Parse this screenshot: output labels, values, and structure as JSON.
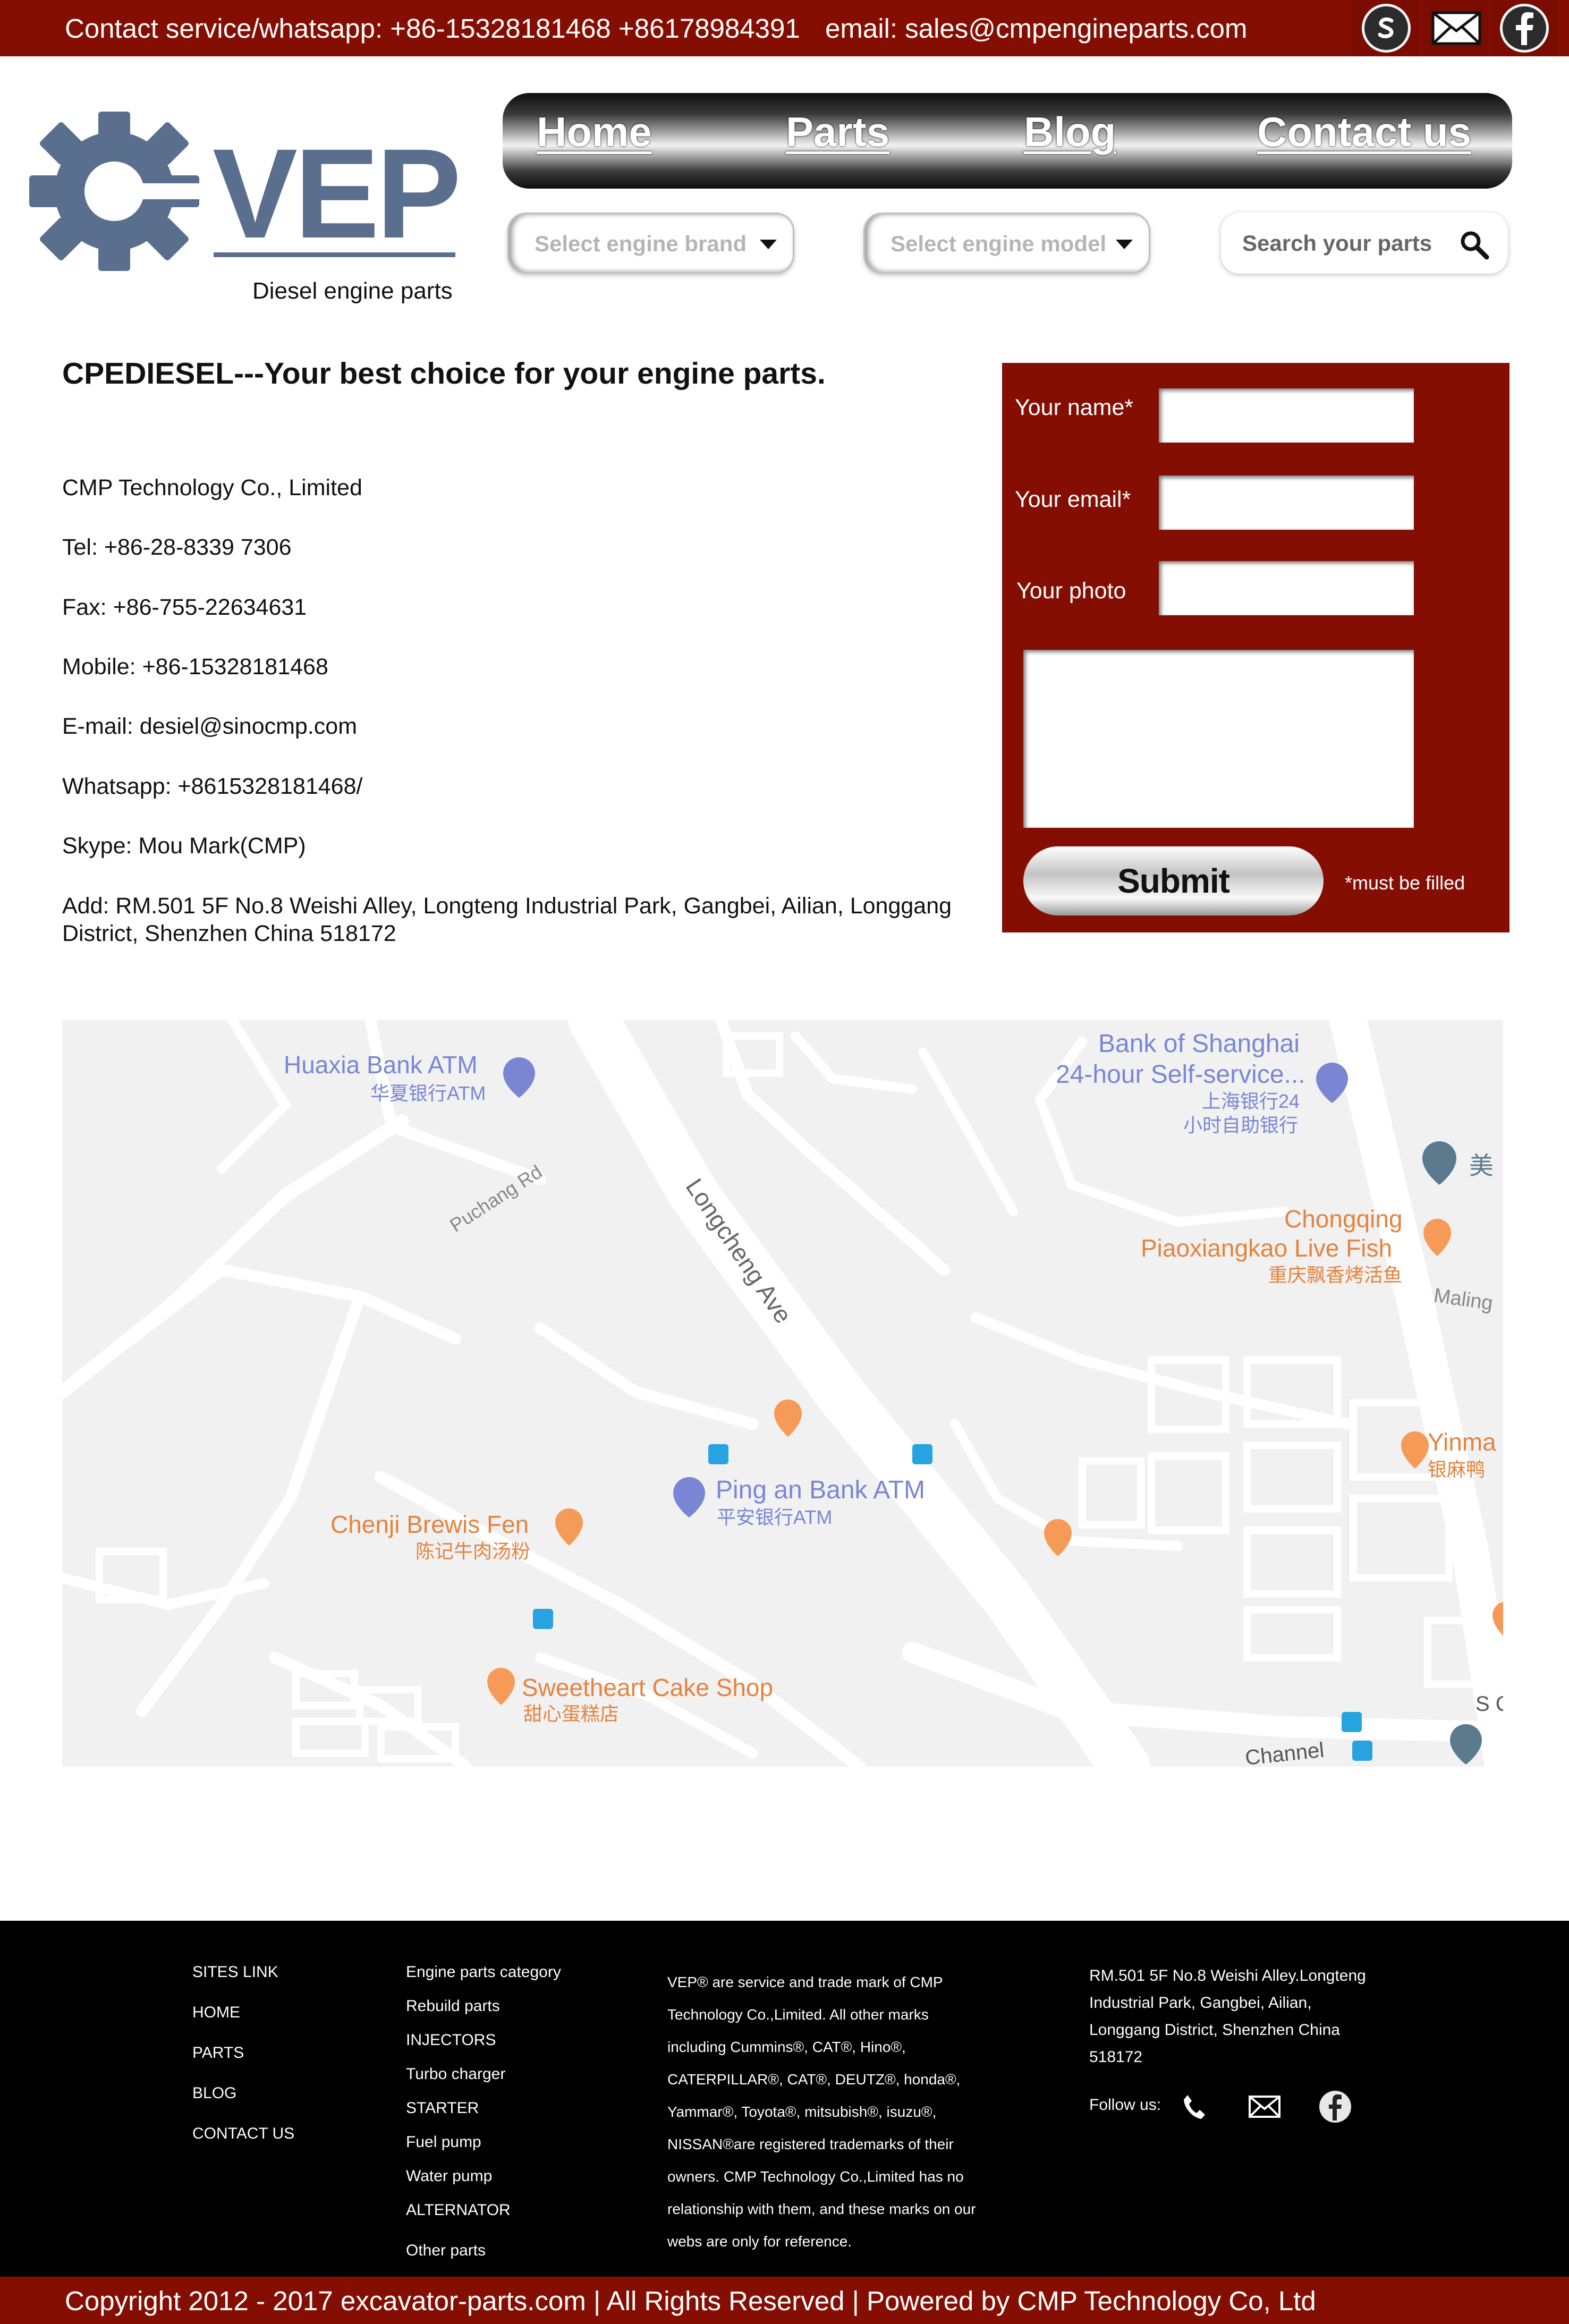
{
  "topbar": {
    "contact": "Contact service/whatsapp: +86-15328181468 +86178984391",
    "email": "email: sales@cmpengineparts.com",
    "icons": [
      "skype-icon",
      "mail-icon",
      "facebook-icon"
    ]
  },
  "logo": {
    "text": "VEP",
    "tagline": "Diesel engine parts"
  },
  "nav": {
    "items": [
      "Home",
      "Parts",
      "Blog",
      "Contact us"
    ]
  },
  "filters": {
    "brand_placeholder": "Select engine brand",
    "model_placeholder": "Select engine model",
    "search_placeholder": "Search your parts"
  },
  "main": {
    "heading": "CPEDIESEL---Your best choice for your engine parts.",
    "company": "CMP Technology Co., Limited",
    "tel": "Tel: +86-28-8339 7306",
    "fax": "Fax: +86-755-22634631",
    "mobile": "Mobile: +86-15328181468",
    "email": "E-mail: desiel@sinocmp.com",
    "whatsapp": "Whatsapp: +8615328181468/",
    "skype": "Skype: Mou Mark(CMP)",
    "address": "Add: RM.501 5F No.8 Weishi Alley, Longteng Industrial Park, Gangbei, Ailian, Longgang District, Shenzhen China 518172"
  },
  "form": {
    "name_label": "Your name*",
    "email_label": "Your email*",
    "photo_label": "Your photo",
    "submit_label": "Submit",
    "required_note": "*must be filled"
  },
  "map": {
    "labels": {
      "huaxia": "Huaxia Bank ATM",
      "huaxia_cn": "华夏银行ATM",
      "shanghai1": "Bank of Shanghai",
      "shanghai2": "24-hour Self-service...",
      "shanghai_cn1": "上海银行24",
      "shanghai_cn2": "小时自助银行",
      "mei": "美",
      "puchang": "Puchang Rd",
      "longcheng": "Longcheng Ave",
      "chongqing1": "Chongqing",
      "chongqing2": "Piaoxiangkao Live Fish",
      "chongqing_cn": "重庆飘香烤活鱼",
      "maling": "Maling",
      "yinma": "Yinma",
      "yinma_cn": "银麻鸭",
      "pingan": "Ping an Bank ATM",
      "pingan_cn": "平安银行ATM",
      "chenji": "Chenji Brewis Fen",
      "chenji_cn": "陈记牛肉汤粉",
      "sweetheart": "Sweetheart Cake Shop",
      "sweetheart_cn": "甜心蛋糕店",
      "channel": "Channel",
      "sc": "S C"
    }
  },
  "footer": {
    "sites": [
      "SITES LINK",
      "HOME",
      "PARTS",
      "BLOG",
      "CONTACT US"
    ],
    "categories": [
      "Engine parts category",
      "Rebuild parts",
      "INJECTORS",
      "Turbo charger",
      "STARTER",
      "Fuel pump",
      "Water pump",
      "ALTERNATOR",
      "Other parts"
    ],
    "disclaimer": "VEP® are service and trade mark of CMP Technology Co.,Limited. All other marks including Cummins®, CAT®, Hino®, CATERPILLAR®, CAT®, DEUTZ®, honda®, Yammar®, Toyota®, mitsubish®, isuzu®, NISSAN®are registered trademarks of their owners. CMP Technology Co.,Limited has no relationship with them, and these marks on our webs are only for reference.",
    "address": "RM.501 5F No.8 Weishi Alley.Longteng Industrial Park, Gangbei, Ailian, Longgang District, Shenzhen China 518172",
    "follow": "Follow us:",
    "icons": [
      "phone-icon",
      "mail-icon",
      "facebook-icon"
    ]
  },
  "copyright": "Copyright 2012 - 2017 excavator-parts.com | All Rights Reserved | Powered by CMP Technology Co, Ltd",
  "colors": {
    "brand_red": "#850e03",
    "logo_blue": "#5a6f8e",
    "footer_bg": "#000000"
  }
}
